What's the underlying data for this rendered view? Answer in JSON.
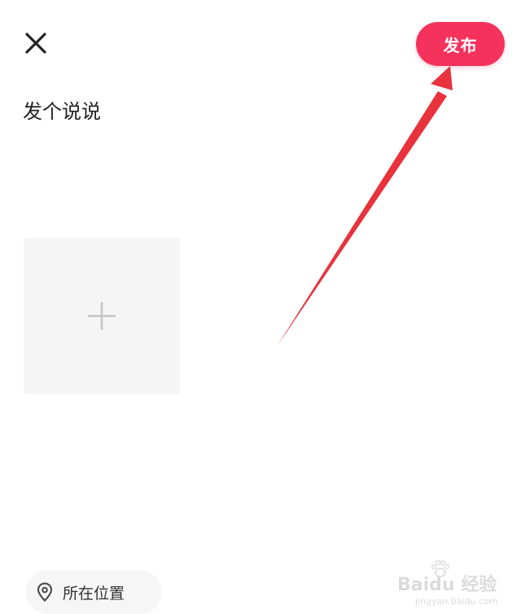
{
  "header": {
    "close_icon": "close-icon",
    "publish_label": "发布",
    "publish_color": "#f5325c"
  },
  "editor": {
    "placeholder": "发个说说"
  },
  "media": {
    "add_icon": "plus-icon",
    "tile_color": "#f5f5f5"
  },
  "location": {
    "icon": "location-pin-icon",
    "label": "所在位置"
  },
  "annotation": {
    "color": "#e8323c"
  },
  "watermark": {
    "brand": "Bai",
    "suffix": "经验",
    "url": "jingyan.baidu.com"
  }
}
